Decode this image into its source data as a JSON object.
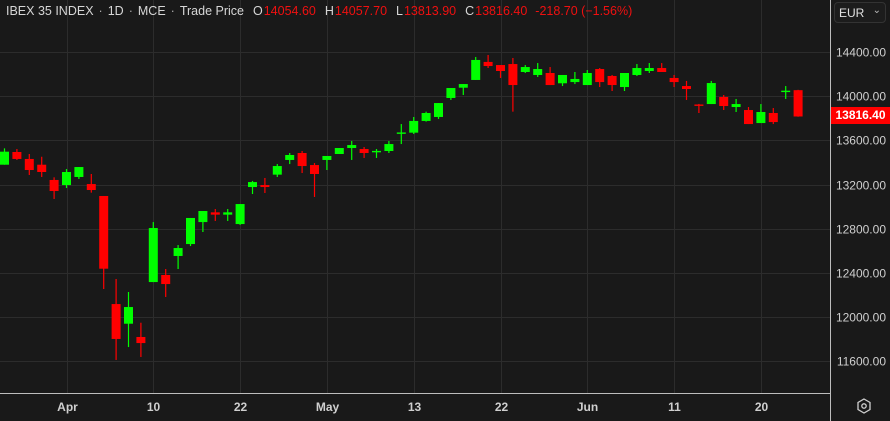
{
  "header": {
    "symbol": "IBEX 35 INDEX",
    "interval": "1D",
    "exchange": "MCE",
    "price_type": "Trade Price",
    "separator": "·",
    "open_label": "O",
    "open": "14054.60",
    "high_label": "H",
    "high": "14057.70",
    "low_label": "L",
    "low": "13813.90",
    "close_label": "C",
    "close": "13816.40",
    "change": "-218.70 (−1.56%)"
  },
  "currency_select": {
    "value": "EUR",
    "icon": "chevron-down-icon"
  },
  "current_price_label": "13816.40",
  "settings_icon": "gear-icon",
  "colors": {
    "up": "#00ff00",
    "down": "#ff0000",
    "background": "#191919",
    "grid": "#2c2c2c"
  },
  "chart_data": {
    "type": "candlestick",
    "title": "IBEX 35 INDEX · 1D · MCE · Trade Price",
    "ylim": [
      11300,
      14600
    ],
    "grid": true,
    "y_ticks": [
      "14400.00",
      "14000.00",
      "13600.00",
      "13200.00",
      "12800.00",
      "12400.00",
      "12000.00",
      "11600.00"
    ],
    "y_tick_values": [
      14400,
      14000,
      13600,
      13200,
      12800,
      12400,
      12000,
      11600
    ],
    "x_ticks": [
      {
        "label": "Apr",
        "index": 5
      },
      {
        "label": "10",
        "index": 12
      },
      {
        "label": "22",
        "index": 19
      },
      {
        "label": "May",
        "index": 26
      },
      {
        "label": "13",
        "index": 33
      },
      {
        "label": "22",
        "index": 40
      },
      {
        "label": "Jun",
        "index": 47
      },
      {
        "label": "11",
        "index": 54
      },
      {
        "label": "20",
        "index": 61
      }
    ],
    "ohlc": [
      [
        13380,
        13528,
        13380,
        13498
      ],
      [
        13495,
        13522,
        13423,
        13432
      ],
      [
        13432,
        13477,
        13287,
        13332
      ],
      [
        13380,
        13452,
        13269,
        13314
      ],
      [
        13242,
        13266,
        13070,
        13142
      ],
      [
        13196,
        13341,
        13169,
        13314
      ],
      [
        13269,
        13359,
        13251,
        13359
      ],
      [
        13205,
        13296,
        13127,
        13151
      ],
      [
        13097,
        13097,
        12255,
        12439
      ],
      [
        12119,
        12346,
        11613,
        11803
      ],
      [
        11941,
        12228,
        11730,
        12092
      ],
      [
        11821,
        11950,
        11640,
        11766
      ],
      [
        12318,
        12861,
        12318,
        12807
      ],
      [
        12382,
        12436,
        12183,
        12300
      ],
      [
        12554,
        12653,
        12436,
        12626
      ],
      [
        12662,
        12898,
        12644,
        12898
      ],
      [
        12861,
        12961,
        12771,
        12961
      ],
      [
        12949,
        12979,
        12871,
        12928
      ],
      [
        12928,
        12979,
        12871,
        12949
      ],
      [
        12843,
        13024,
        12835,
        13024
      ],
      [
        13178,
        13233,
        13115,
        13223
      ],
      [
        13196,
        13260,
        13124,
        13178
      ],
      [
        13290,
        13386,
        13269,
        13368
      ],
      [
        13423,
        13486,
        13386,
        13468
      ],
      [
        13486,
        13504,
        13305,
        13368
      ],
      [
        13377,
        13395,
        13088,
        13296
      ],
      [
        13423,
        13459,
        13332,
        13459
      ],
      [
        13477,
        13531,
        13477,
        13531
      ],
      [
        13531,
        13595,
        13423,
        13558
      ],
      [
        13522,
        13540,
        13441,
        13486
      ],
      [
        13495,
        13522,
        13441,
        13505
      ],
      [
        13504,
        13595,
        13486,
        13567
      ],
      [
        13662,
        13748,
        13567,
        13672
      ],
      [
        13670,
        13812,
        13658,
        13776
      ],
      [
        13776,
        13860,
        13770,
        13848
      ],
      [
        13812,
        13938,
        13794,
        13938
      ],
      [
        13984,
        14074,
        13966,
        14074
      ],
      [
        14077,
        14110,
        14011,
        14110
      ],
      [
        14147,
        14355,
        14147,
        14328
      ],
      [
        14310,
        14373,
        14255,
        14273
      ],
      [
        14282,
        14282,
        14165,
        14228
      ],
      [
        14291,
        14346,
        13860,
        14101
      ],
      [
        14219,
        14282,
        14210,
        14264
      ],
      [
        14192,
        14300,
        14174,
        14246
      ],
      [
        14210,
        14264,
        14101,
        14101
      ],
      [
        14117,
        14192,
        14092,
        14192
      ],
      [
        14128,
        14219,
        14110,
        14156
      ],
      [
        14101,
        14237,
        14101,
        14210
      ],
      [
        14246,
        14255,
        14083,
        14128
      ],
      [
        14183,
        14192,
        14047,
        14101
      ],
      [
        14083,
        14210,
        14047,
        14210
      ],
      [
        14192,
        14291,
        14183,
        14255
      ],
      [
        14228,
        14300,
        14210,
        14255
      ],
      [
        14255,
        14300,
        14219,
        14219
      ],
      [
        14165,
        14192,
        14083,
        14128
      ],
      [
        14092,
        14138,
        13966,
        14065
      ],
      [
        13925,
        13930,
        13848,
        13920
      ],
      [
        13929,
        14138,
        13929,
        14119
      ],
      [
        13993,
        14011,
        13875,
        13911
      ],
      [
        13902,
        13975,
        13857,
        13929
      ],
      [
        13875,
        13902,
        13748,
        13748
      ],
      [
        13757,
        13929,
        13757,
        13857
      ],
      [
        13848,
        13893,
        13748,
        13766
      ],
      [
        14042,
        14092,
        13975,
        14050
      ],
      [
        14054.6,
        14057.7,
        13813.9,
        13816.4
      ]
    ]
  }
}
